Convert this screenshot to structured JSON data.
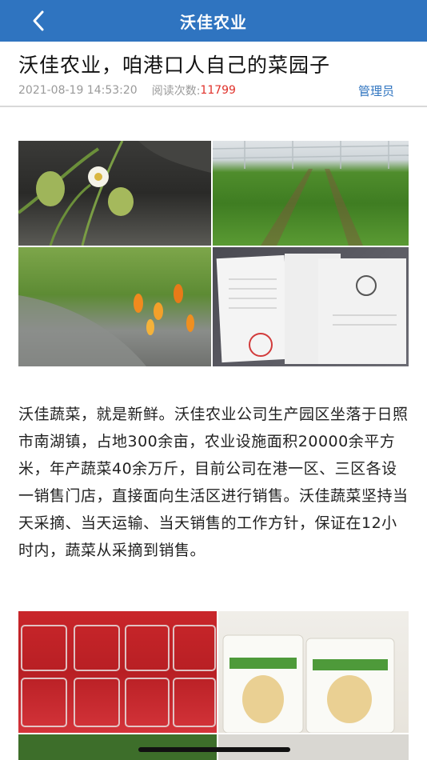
{
  "navbar": {
    "title": "沃佳农业",
    "back_icon": "chevron-left-icon"
  },
  "article": {
    "title": "沃佳农业，咱港口人自己的菜园子",
    "datetime": "2021-08-19 14:53:20",
    "reads_label": "阅读次数:",
    "reads_count": "11799",
    "author": "管理员",
    "body": "沃佳蔬菜，就是新鲜。沃佳农业公司生产园区坐落于日照市南湖镇，占地300余亩，农业设施面积20000余平方米，年产蔬菜40余万斤，目前公司在港一区、三区各设一销售门店，直接面向生活区进行销售。沃佳蔬菜坚持当天采摘、当天运输、当天销售的工作方针，保证在12小时内，蔬菜从采摘到销售。"
  },
  "colors": {
    "navbar": "#2f74c0",
    "reads_count": "#e0322b",
    "author": "#2f74c0"
  }
}
